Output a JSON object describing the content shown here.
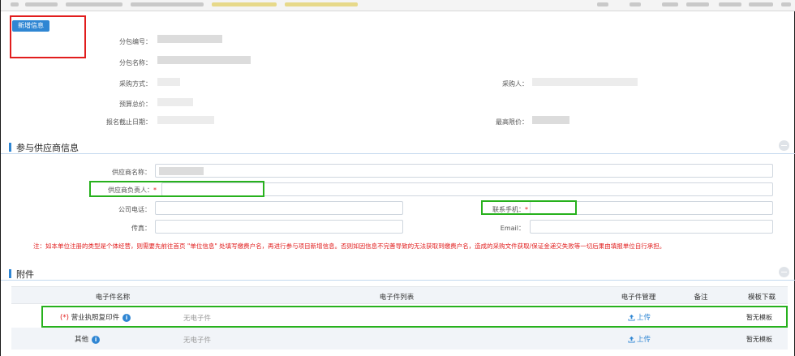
{
  "toolbar": {
    "add_info_label": "新增信息"
  },
  "package_info": {
    "package_no_label": "分包编号：",
    "package_name_label": "分包名称：",
    "purchase_method_label": "采购方式：",
    "budget_label": "预算总价：",
    "deadline_label": "报名截止日期：",
    "purchaser_label": "采购人：",
    "max_price_label": "最高限价："
  },
  "supplier_section": {
    "title": "参与供应商信息",
    "supplier_name_label": "供应商名称：",
    "contact_person_label": "供应商负责人：",
    "company_phone_label": "公司电话：",
    "mobile_label": "联系手机：",
    "fax_label": "传真：",
    "email_label": "Email：",
    "required_mark": "*",
    "notice": "注：如本单位注册的类型是个体经营，则需要先前往首页 \"单位信息\" 处填写缴费户名，再进行参与项目新增信息。否则如因信息不完善导致的无法获取到缴费户名，造成的采购文件获取/保证金递交失败等一切后果由填报单位自行承担。"
  },
  "attachment_section": {
    "title": "附件",
    "columns": [
      "电子件名称",
      "电子件列表",
      "电子件管理",
      "备注",
      "模板下载"
    ],
    "rows": [
      {
        "name_prefix": "(*)",
        "name": "营业执照复印件",
        "info_icon": "i",
        "list": "无电子件",
        "manage": "上传",
        "note": "",
        "template": "暂无模板"
      },
      {
        "name_prefix": "",
        "name": "其他",
        "info_icon": "i",
        "list": "无电子件",
        "manage": "上传",
        "note": "",
        "template": "暂无模板"
      }
    ]
  },
  "colors": {
    "accent": "#2f86d3",
    "highlight_red": "#e11d1d",
    "highlight_green": "#27b11d"
  }
}
